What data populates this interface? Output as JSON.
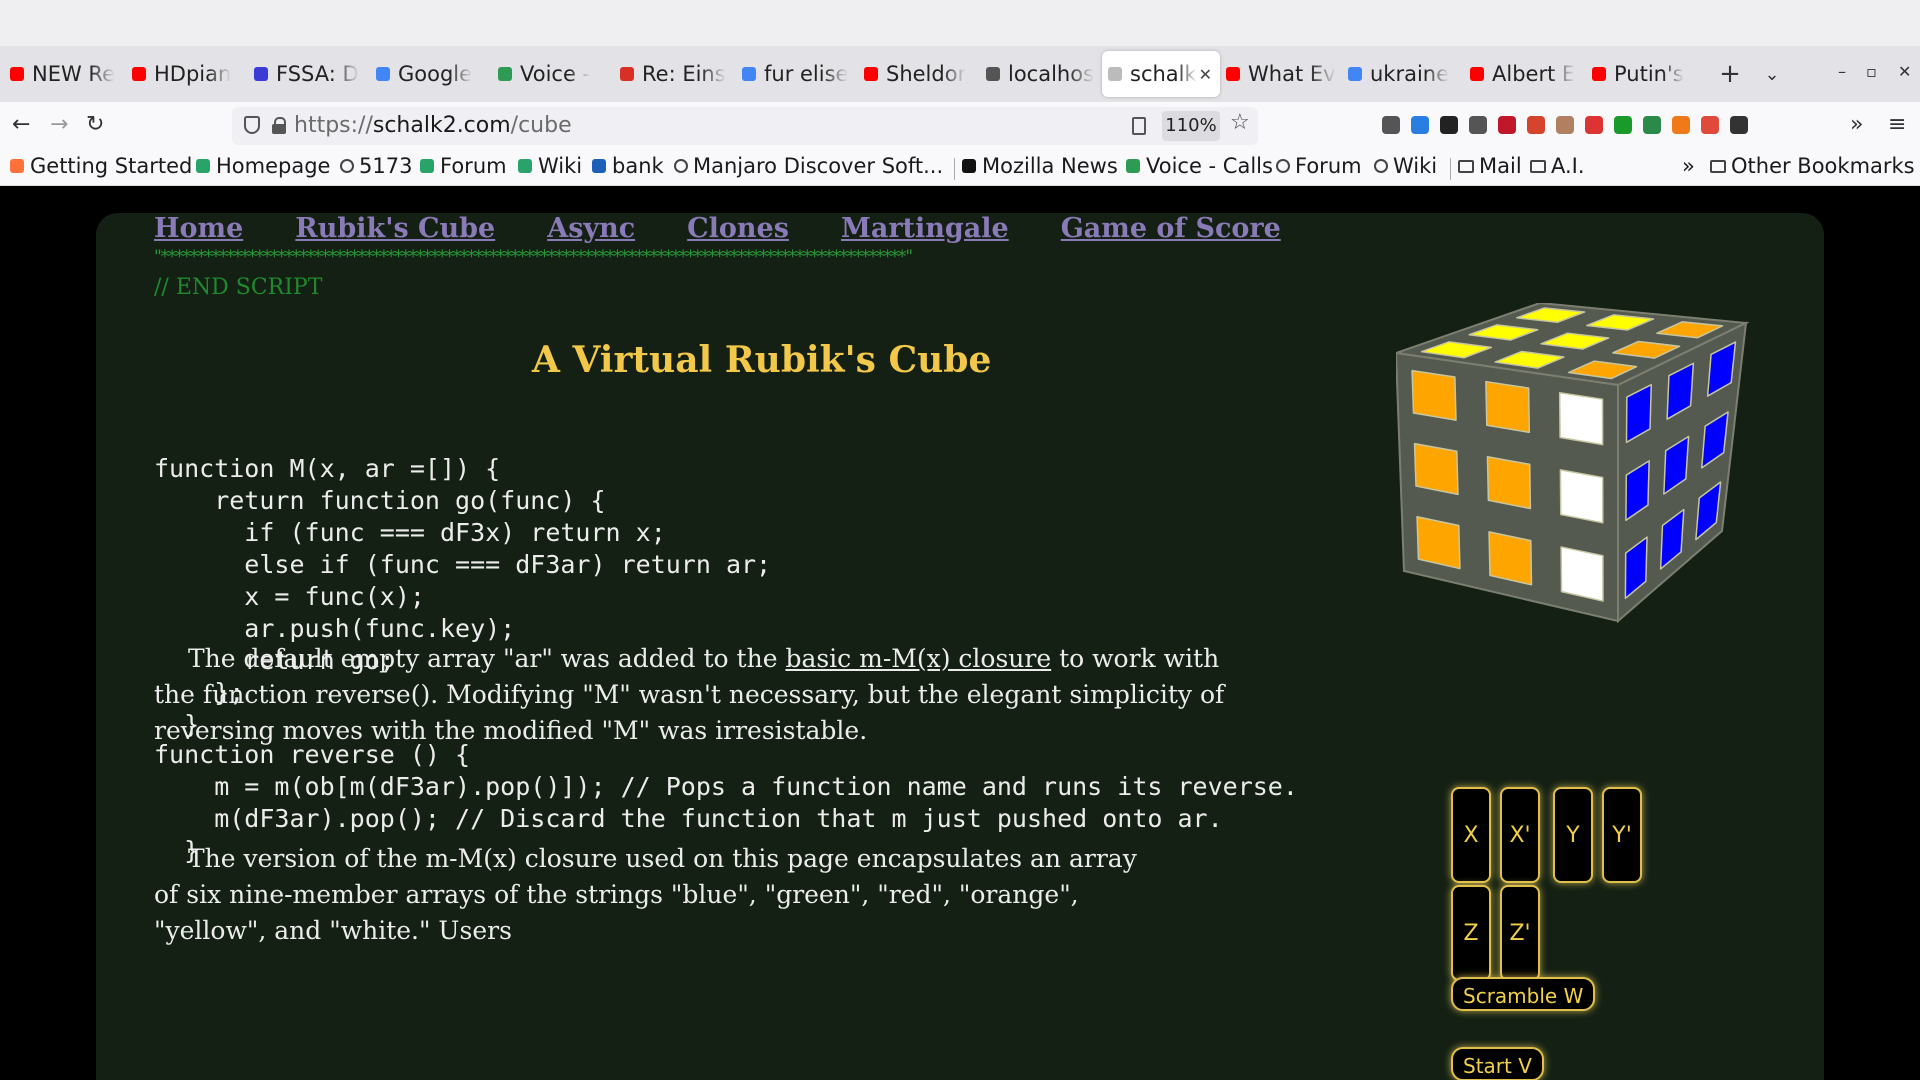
{
  "browser": {
    "tabs": [
      {
        "label": "NEW Re",
        "color": "#ff0000"
      },
      {
        "label": "HDpian",
        "color": "#ff0000"
      },
      {
        "label": "FSSA: D",
        "color": "#3b3bd6"
      },
      {
        "label": "Google",
        "color": "#4285f4"
      },
      {
        "label": "Voice -",
        "color": "#2e9b55"
      },
      {
        "label": "Re: Eins",
        "color": "#d93025"
      },
      {
        "label": "fur elise",
        "color": "#4285f4"
      },
      {
        "label": "Sheldor",
        "color": "#ff0000"
      },
      {
        "label": "localhos",
        "color": "#555555"
      },
      {
        "label": "schalk",
        "color": "#bbbbbb"
      },
      {
        "label": "What Ev",
        "color": "#ff0000"
      },
      {
        "label": "ukraine",
        "color": "#4285f4"
      },
      {
        "label": "Albert E",
        "color": "#ff0000"
      },
      {
        "label": "Putin's",
        "color": "#ff0000"
      }
    ],
    "active_tab_index": 9,
    "new_tab": "+",
    "list_all": "⌄",
    "window_controls": {
      "minimize": "–",
      "maximize": "▫",
      "close": "✕"
    },
    "nav": {
      "back": "←",
      "forward": "→",
      "reload": "↻"
    },
    "url": {
      "scheme": "https://",
      "host": "schalk2.com",
      "path": "/cube"
    },
    "zoom": "110%",
    "star": "☆",
    "menu": "≡",
    "bookmarks_overflow": "»",
    "bookmarks": [
      {
        "label": "Getting Started",
        "icon": "firefox-icon"
      },
      {
        "label": "Homepage",
        "icon": "homepage-icon"
      },
      {
        "label": "5173",
        "icon": "globe-icon"
      },
      {
        "label": "Forum",
        "icon": "forum-icon"
      },
      {
        "label": "Wiki",
        "icon": "wiki-icon"
      },
      {
        "label": "bank",
        "icon": "bank-icon"
      },
      {
        "label": "Manjaro Discover Soft...",
        "icon": "globe-icon"
      },
      {
        "label": "Mozilla News",
        "icon": "mozilla-icon"
      },
      {
        "label": "Voice - Calls",
        "icon": "voice-icon"
      },
      {
        "label": "Forum",
        "icon": "globe-icon"
      },
      {
        "label": "Wiki",
        "icon": "globe-icon"
      },
      {
        "label": "Mail",
        "icon": "folder-icon"
      },
      {
        "label": "A.I.",
        "icon": "folder-icon"
      },
      {
        "label": "Other Bookmarks",
        "icon": "folder-icon"
      }
    ]
  },
  "page": {
    "nav": [
      "Home",
      "Rubik's Cube",
      "Async",
      "Clones",
      "Martingale",
      "Game of Score"
    ],
    "stars_line": "\"******************************************************************************************************\"",
    "end_script": "// END SCRIPT",
    "title": "A Virtual Rubik's Cube",
    "code1": "function M(x, ar =[]) {\n    return function go(func) {\n      if (func === dF3x) return x;\n      else if (func === dF3ar) return ar;\n      x = func(x);\n      ar.push(func.key);\n      return go;\n    };\n  }",
    "para1_before": "The default empty array \"ar\" was added to the ",
    "para1_link": "basic m-M(x) closure",
    "para1_after": " to work with the function reverse(). Modifying \"M\" wasn't necessary, but the elegant simplicity of reversing moves with the modified \"M\" was irresistable.",
    "code2": "function reverse () {\n    m = m(ob[m(dF3ar).pop()]); // Pops a function name and runs its reverse.\n    m(dF3ar).pop(); // Discard the function that m just pushed onto ar.\n  }",
    "para2": "The version of the m-M(x) closure used on this page encapsulates an array of six nine-member arrays of the strings \"blue\", \"green\", \"red\", \"orange\", \"yellow\", and \"white.\" Users",
    "buttons": [
      "X",
      "X'",
      "Y",
      "Y'",
      "Z",
      "Z'"
    ],
    "scramble": "Scramble W",
    "start": "Start V",
    "cube_faces": {
      "top": [
        "yellow",
        "yellow",
        "orange",
        "yellow",
        "yellow",
        "orange",
        "yellow",
        "yellow",
        "orange"
      ],
      "front": [
        "orange",
        "orange",
        "white",
        "orange",
        "orange",
        "white",
        "orange",
        "orange",
        "white"
      ],
      "right": [
        "blue",
        "blue",
        "blue",
        "blue",
        "blue",
        "blue",
        "blue",
        "blue",
        "blue"
      ]
    },
    "colors": {
      "panel_bg": "#142014",
      "title": "#f1c84a",
      "nav_link": "#8a7ab8",
      "button_gold": "#e0c04a",
      "yellow": "#ffff00",
      "orange": "#ffa500",
      "white": "#ffffff",
      "blue": "#0000ff"
    }
  }
}
